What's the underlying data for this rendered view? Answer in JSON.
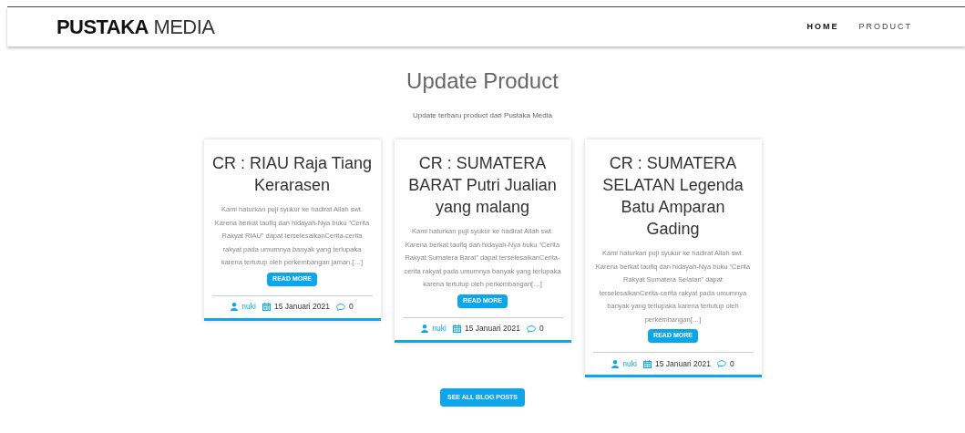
{
  "header": {
    "logo_strong": "PUSTAKA",
    "logo_light": "MEDIA",
    "nav": [
      {
        "label": "HOME",
        "selected": true
      },
      {
        "label": "PRODUCT",
        "selected": false
      }
    ]
  },
  "section": {
    "title": "Update Product",
    "subtitle": "Update terbaru product dari Pustaka Media"
  },
  "posts": [
    {
      "title": "CR : RIAU Raja Tiang Kerarasen",
      "excerpt": "Kami haturkan puji syukur ke hadirat Allah swt. Karena berkat taufiq dan hidayah-Nya buku “Cerita Rakyat RIAU” dapat terselesaikanCerita-cerita rakyat pada umumnya banyak yang terlupaka karena tertutup oleh perkembangan jaman.[…]",
      "button": "READ MORE",
      "author": "nuki",
      "date": "15 Januari 2021",
      "comments": "0"
    },
    {
      "title": "CR : SUMATERA BARAT Putri Jualian yang malang",
      "excerpt": "Kami haturkan puji syukur ke hadirat Allah swt. Karena berkat taufiq dan hidayah-Nya buku “Cerita Rakyat Sumatera Barat” dapat terselesaikanCerita-cerita rakyat pada umumnya banyak yang terlupaka karena tertutup oleh perkembangan[…]",
      "button": "READ MORE",
      "author": "nuki",
      "date": "15 Januari 2021",
      "comments": "0"
    },
    {
      "title": "CR : SUMATERA SELATAN Legenda Batu Amparan Gading",
      "excerpt": "Kami haturkan puji syukur ke hadirat Allah swt. Karena berkat taufiq dan hidayah-Nya buku “Cerita Rakyat Sumatera Selatan” dapat terselesaikanCerita-cerita rakyat pada umumnya banyak yang terlupaka karena tertutup oleh perkembangan[…]",
      "button": "READ MORE",
      "author": "nuki",
      "date": "15 Januari 2021",
      "comments": "0"
    }
  ],
  "footer_button": "SEE ALL BLOG POSTS"
}
